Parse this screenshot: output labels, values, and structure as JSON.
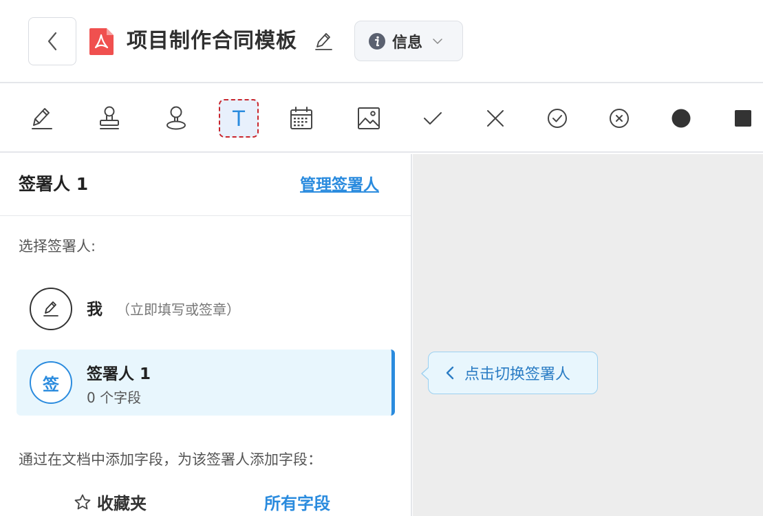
{
  "header": {
    "title": "项目制作合同模板",
    "info_label": "信息"
  },
  "toolbar": {
    "tools": [
      {
        "name": "signature-tool",
        "icon": "pen-icon"
      },
      {
        "name": "stamp-tool",
        "icon": "stamp-icon"
      },
      {
        "name": "seal-tool",
        "icon": "seal-icon"
      },
      {
        "name": "text-tool",
        "icon": "text-T-icon",
        "label": "T",
        "active": true
      },
      {
        "name": "date-tool",
        "icon": "calendar-icon"
      },
      {
        "name": "image-tool",
        "icon": "image-icon"
      },
      {
        "name": "check-tool",
        "icon": "check-icon"
      },
      {
        "name": "cross-tool",
        "icon": "cross-icon"
      },
      {
        "name": "circle-check-tool",
        "icon": "circle-check-icon"
      },
      {
        "name": "circle-cross-tool",
        "icon": "circle-cross-icon"
      },
      {
        "name": "dot-tool",
        "icon": "filled-circle-icon"
      },
      {
        "name": "square-tool",
        "icon": "filled-square-icon"
      }
    ]
  },
  "panel": {
    "title": "签署人 1",
    "manage_link": "管理签署人",
    "select_label": "选择签署人:",
    "me": {
      "name": "我",
      "desc": "（立即填写或签章）"
    },
    "signer1": {
      "avatar": "签",
      "name": "签署人 1",
      "count": "0 个字段"
    },
    "hint": "通过在文档中添加字段，为该签署人添加字段：",
    "tabs": {
      "favorites": "收藏夹",
      "all": "所有字段"
    }
  },
  "tooltip": {
    "text": "点击切换签署人"
  },
  "colors": {
    "accent": "#2a8bde",
    "active_border": "#c9252c",
    "pdf_red": "#f0504f",
    "doc_bg": "#ededed"
  }
}
